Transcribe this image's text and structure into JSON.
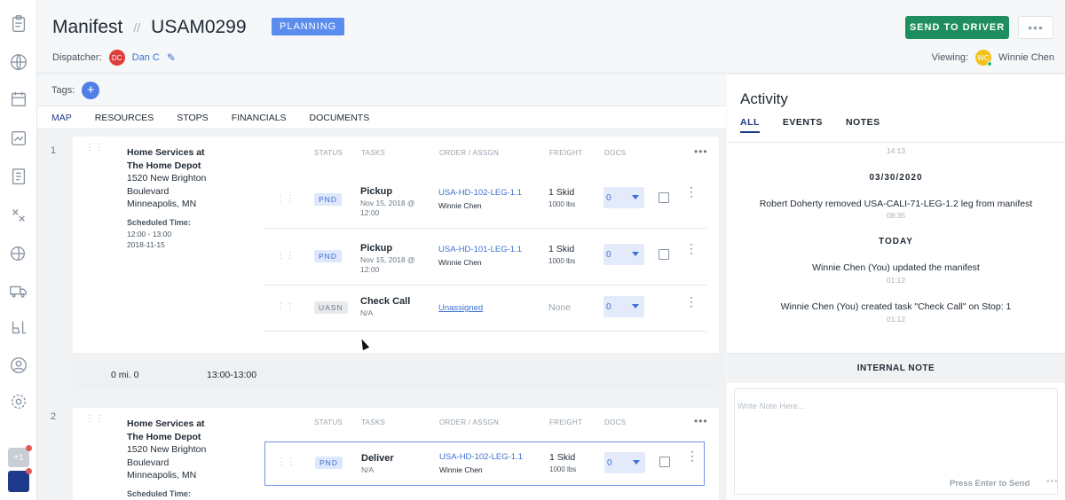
{
  "sidebar": {
    "icons": [
      "clipboard-icon",
      "globe-icon",
      "calendar-icon",
      "map-icon",
      "invoice-icon",
      "routes-icon",
      "location-globe-icon",
      "truck-icon",
      "forklift-icon",
      "user-circle-icon",
      "settings-icon"
    ],
    "plus_badge": "+1"
  },
  "header": {
    "title": "Manifest",
    "separator": "//",
    "manifest_id": "USAM0299",
    "status": "PLANNING",
    "send_button": "SEND TO DRIVER",
    "more_button": "•••",
    "dispatcher_label": "Dispatcher:",
    "dispatcher_initials": "DC",
    "dispatcher_name": "Dan C",
    "viewing_label": "Viewing:",
    "viewer_initials": "WC",
    "viewer_name": "Winnie Chen"
  },
  "tags": {
    "label": "Tags:",
    "add": "+"
  },
  "tabs": [
    "MAP",
    "RESOURCES",
    "STOPS",
    "FINANCIALS",
    "DOCUMENTS"
  ],
  "columns": {
    "status": "STATUS",
    "tasks": "TASKS",
    "order": "ORDER / ASSGN",
    "freight": "FREIGHT",
    "docs": "DOCS"
  },
  "stops": [
    {
      "number": "1",
      "name_line1": "Home Services at",
      "name_line2": "The Home Depot",
      "street": "1520 New Brighton",
      "street2": "Boulevard",
      "city": "Minneapolis, MN",
      "sched_label": "Scheduled Time:",
      "sched_time": "12:00 - 13:00",
      "sched_date": "2018-11-15",
      "tasks": [
        {
          "status": "PND",
          "name": "Pickup",
          "sub1": "Nov 15, 2018 @",
          "sub2": "12:00",
          "order": "USA-HD-102-LEG-1.1",
          "assignee": "Winnie Chen",
          "freight": "1 Skid",
          "freight_sub": "1000 lbs",
          "docs": "0"
        },
        {
          "status": "PND",
          "name": "Pickup",
          "sub1": "Nov 15, 2018 @",
          "sub2": "12:00",
          "order": "USA-HD-101-LEG-1.1",
          "assignee": "Winnie Chen",
          "freight": "1 Skid",
          "freight_sub": "1000 lbs",
          "docs": "0"
        },
        {
          "status": "UASN",
          "name": "Check Call",
          "sub1": "N/A",
          "sub2": "",
          "order": "Unassigned",
          "assignee": "",
          "freight": "None",
          "freight_sub": "",
          "docs": "0"
        }
      ]
    },
    {
      "number": "2",
      "name_line1": "Home Services at",
      "name_line2": "The Home Depot",
      "street": "1520 New Brighton",
      "street2": "Boulevard",
      "city": "Minneapolis, MN",
      "sched_label": "Scheduled Time:",
      "tasks": [
        {
          "status": "PND",
          "name": "Deliver",
          "sub1": "N/A",
          "sub2": "",
          "order": "USA-HD-102-LEG-1.1",
          "assignee": "Winnie Chen",
          "freight": "1 Skid",
          "freight_sub": "1000 lbs",
          "docs": "0"
        }
      ]
    }
  ],
  "summary": {
    "distance": "0 mi. 0",
    "window": "13:00-13:00"
  },
  "activity": {
    "title": "Activity",
    "tabs": [
      "ALL",
      "EVENTS",
      "NOTES"
    ],
    "feed": {
      "time0": "14:13",
      "date1": "03/30/2020",
      "event1": "Robert Doherty removed USA-CALI-71-LEG-1.2 leg from manifest",
      "time1": "08:35",
      "date2": "TODAY",
      "event2": "Winnie Chen (You) updated the manifest",
      "time2": "01:12",
      "event3": "Winnie Chen (You) created task \"Check Call\" on Stop: 1",
      "time3": "01:12"
    },
    "note_title": "INTERNAL NOTE",
    "note_placeholder": "Write Note Here...",
    "note_hint": "Press Enter to Send"
  },
  "colors": {
    "accent": "#1e3a8a",
    "link": "#3b6fd1",
    "send": "#1e8e5e",
    "status_pill": "#5b8def"
  }
}
